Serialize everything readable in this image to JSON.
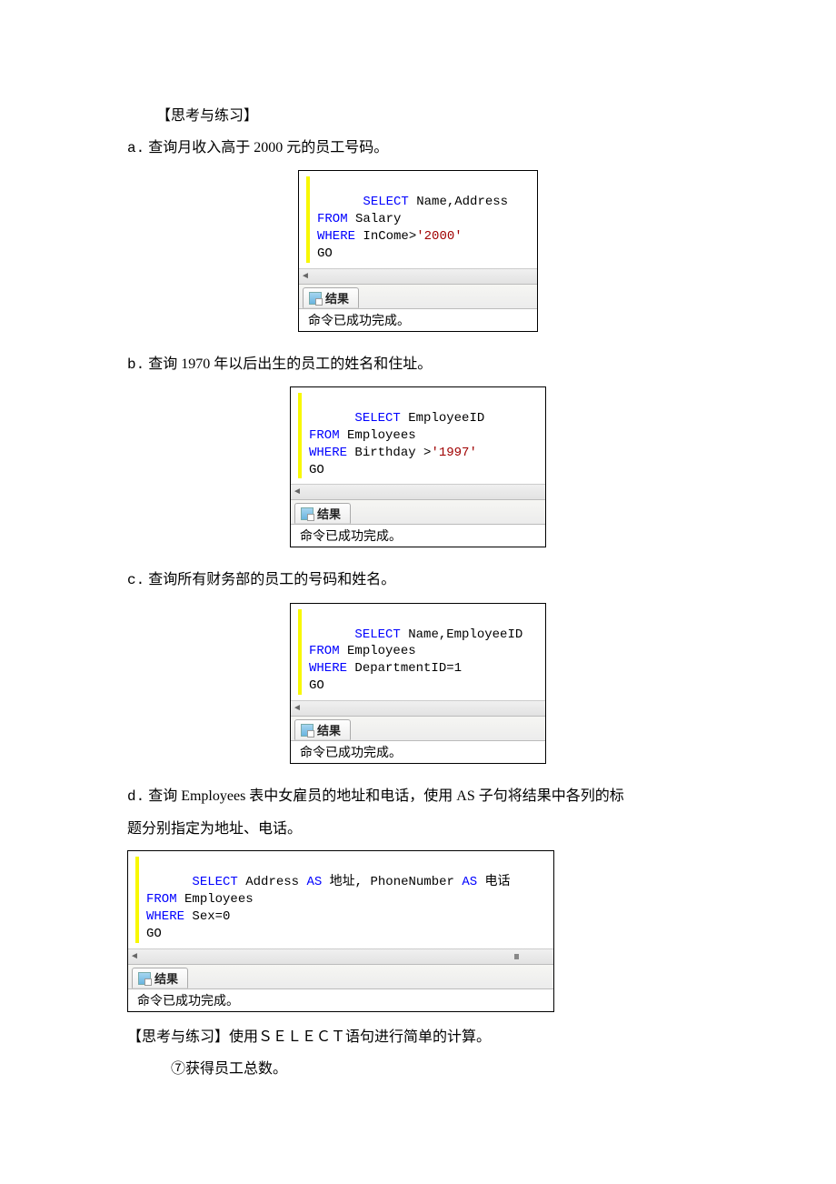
{
  "heading1": "【思考与练习】",
  "items": {
    "a": {
      "prefix": "a.",
      "text": " 查询月收入高于 2000 元的员工号码。",
      "sql": {
        "l1_kw": "SELECT",
        "l1_txt": " Name,Address",
        "l2_kw": "FROM",
        "l2_txt": " Salary",
        "l3_kw": "WHERE",
        "l3_txt": " InCome>",
        "l3_str": "'2000'",
        "l4": "GO"
      },
      "tab_label": "结果",
      "msg": "命令已成功完成。"
    },
    "b": {
      "prefix": "b.",
      "text": " 查询 1970 年以后出生的员工的姓名和住址。",
      "sql": {
        "l1_kw": "SELECT",
        "l1_txt": " EmployeeID",
        "l2_kw": "FROM",
        "l2_txt": " Employees",
        "l3_kw": "WHERE",
        "l3_txt": " Birthday >",
        "l3_str": "'1997'",
        "l4": "GO"
      },
      "tab_label": "结果",
      "msg": "命令已成功完成。"
    },
    "c": {
      "prefix": "c.",
      "text": " 查询所有财务部的员工的号码和姓名。",
      "sql": {
        "l1_kw": "SELECT",
        "l1_txt": " Name,EmployeeID",
        "l2_kw": "FROM",
        "l2_txt": " Employees",
        "l3_kw": "WHERE",
        "l3_txt": " DepartmentID=1",
        "l4": "GO"
      },
      "tab_label": "结果",
      "msg": "命令已成功完成。"
    },
    "d": {
      "prefix": "d.",
      "text1": " 查询 Employees 表中女雇员的地址和电话，使用 AS 子句将结果中各列的标",
      "text2": "题分别指定为地址、电话。",
      "sql": {
        "l1_kw": "SELECT",
        "l1_txt1": " Address ",
        "l1_as1": "AS",
        "l1_txt2": " 地址, PhoneNumber ",
        "l1_as2": "AS",
        "l1_txt3": " 电话",
        "l2_kw": "FROM",
        "l2_txt": " Employees",
        "l3_kw": "WHERE",
        "l3_txt": " Sex=0",
        "l4": "GO"
      },
      "tab_label": "结果",
      "msg": "命令已成功完成。"
    }
  },
  "heading2": "【思考与练习】使用ＳＥＬＥＣＴ语句进行简单的计算。",
  "item7": "⑦获得员工总数。"
}
